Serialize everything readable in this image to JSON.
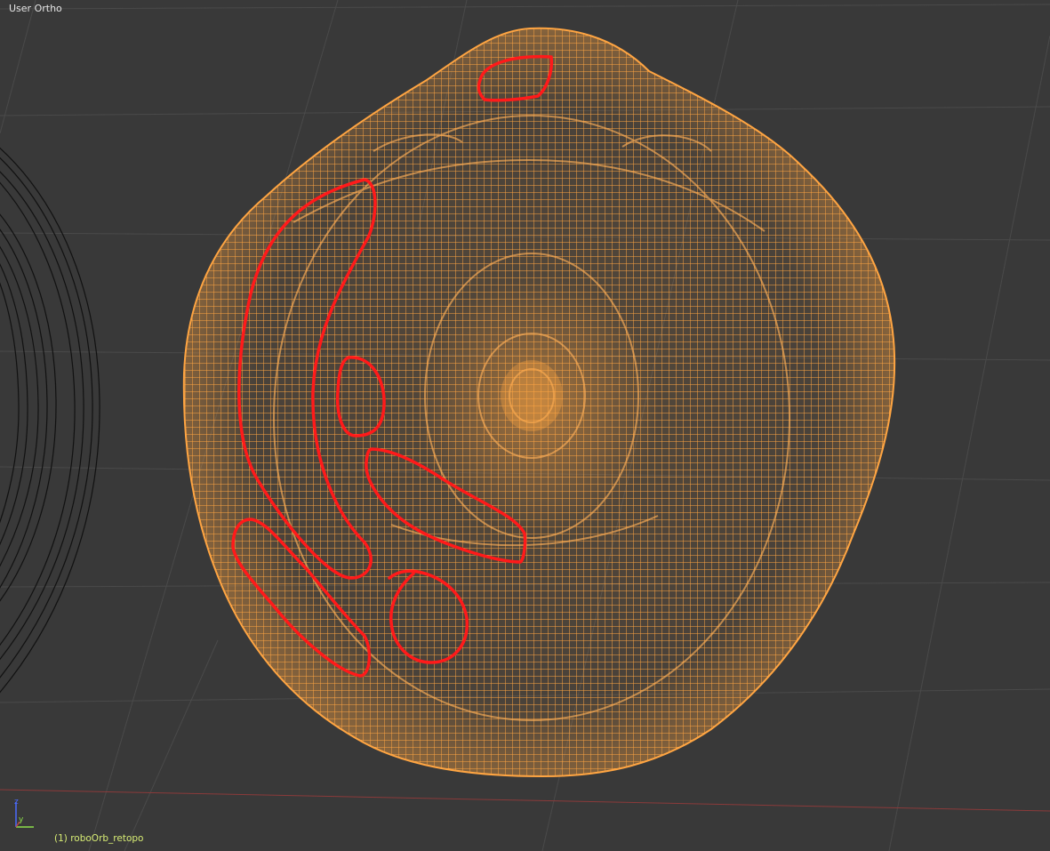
{
  "viewport": {
    "view_label": "User Ortho",
    "object_label": "(1) roboOrb_retopo",
    "background_color": "#393939",
    "grid_color": "#4a4a4a",
    "x_axis_color": "#8b3a3a"
  },
  "mesh": {
    "wire_color": "#ffa542",
    "highlight_color": "#ff1a1a"
  },
  "gizmo": {
    "z_label": "z",
    "y_label": "y",
    "z_color": "#4b6bff",
    "y_color": "#8ce04a"
  }
}
